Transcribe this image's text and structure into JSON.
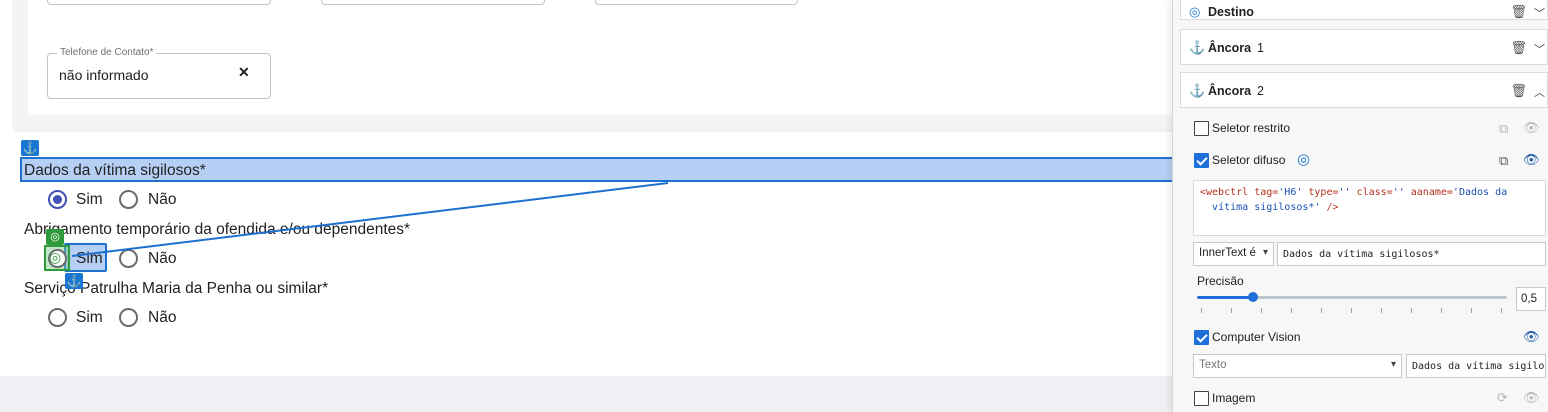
{
  "form": {
    "phone_legend": "Telefone de Contato*",
    "phone_value": "não informado",
    "phone_clear": "✕",
    "questions": [
      {
        "label": "Dados da vítima sigilosos*",
        "yes": "Sim",
        "no": "Não",
        "selected": "Sim"
      },
      {
        "label": "Abrigamento temporário da ofendida e/ou dependentes*",
        "yes": "Sim",
        "no": "Não",
        "selected": ""
      },
      {
        "label": "Serviço Patrulha Maria da Penha ou similar*",
        "yes": "Sim",
        "no": "Não",
        "selected": ""
      }
    ]
  },
  "overlay": {
    "anchor_glyph": "⚓",
    "target_glyph": "◎",
    "colors": {
      "anchor": "#1976d2",
      "target": "#2e9a3a",
      "highlight": "#1f6fd0"
    }
  },
  "panel": {
    "sections": [
      {
        "icon": "target-icon",
        "title": "Destino",
        "num": ""
      },
      {
        "icon": "anchor-icon",
        "title": "Âncora",
        "num": "1"
      },
      {
        "icon": "anchor-icon",
        "title": "Âncora",
        "num": "2"
      }
    ],
    "options": {
      "restricted": {
        "label": "Seletor restrito",
        "checked": false
      },
      "fuzzy": {
        "label": "Seletor difuso",
        "checked": true
      },
      "cv": {
        "label": "Computer Vision",
        "checked": true
      },
      "image": {
        "label": "Imagem",
        "checked": false
      }
    },
    "selector_code": {
      "open": "<webctrl",
      "tag_attr": " tag=",
      "tag_val": "'H6'",
      "type_attr": " type=",
      "type_val": "''",
      "class_attr": " class=",
      "class_val": "''",
      "aaname_attr": " aaname=",
      "aaname_val_1": "'Dados da",
      "aaname_val_2": "vítima sigilosos*'",
      "close": " />"
    },
    "innertext_select": "InnerText é",
    "innertext_value": "Dados da vítima sigilosos*",
    "precision_label": "Precisão",
    "precision_value": "0,5",
    "precision_fraction": 0.18,
    "cv_select": "Texto",
    "cv_value": "Dados da vítima sigilosos*"
  }
}
